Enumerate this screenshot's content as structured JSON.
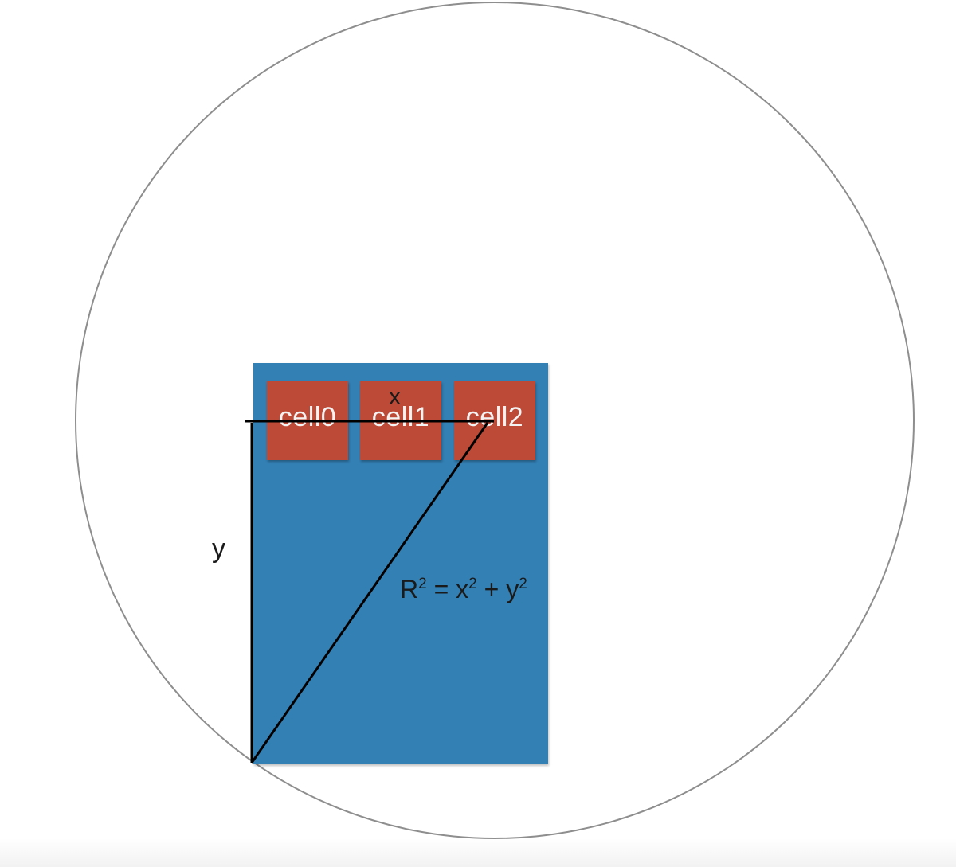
{
  "colors": {
    "circle": "#8e8e8e",
    "panel": "#3380b5",
    "cell": "#bd4a36",
    "cell_text": "#f3f3f3",
    "line": "#000000"
  },
  "cells": [
    {
      "label": "cell0"
    },
    {
      "label": "cell1"
    },
    {
      "label": "cell2"
    }
  ],
  "labels": {
    "x": "x",
    "y": "y"
  },
  "formula": {
    "r": "R",
    "r_exp": "2",
    "eq": " = x",
    "x_exp": "2",
    "plus": " + y",
    "y_exp": "2"
  }
}
